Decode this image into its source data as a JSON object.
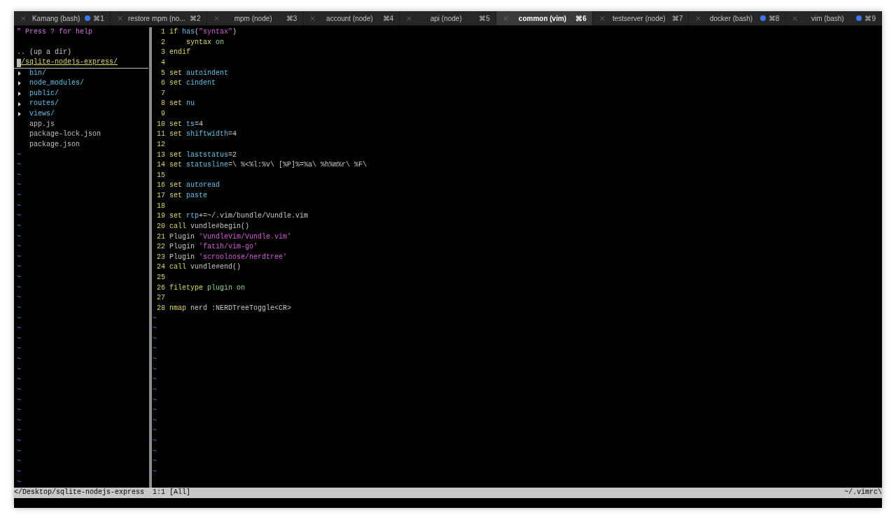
{
  "tabs": [
    {
      "title": "Kamang (bash)",
      "shortcut": "⌘1",
      "selected": false,
      "activity": true
    },
    {
      "title": "restore mpm (no...",
      "shortcut": "⌘2",
      "selected": false,
      "activity": false
    },
    {
      "title": "mpm (node)",
      "shortcut": "⌘3",
      "selected": false,
      "activity": false
    },
    {
      "title": "account (node)",
      "shortcut": "⌘4",
      "selected": false,
      "activity": false
    },
    {
      "title": "api (node)",
      "shortcut": "⌘5",
      "selected": false,
      "activity": false
    },
    {
      "title": "common (vim)",
      "shortcut": "⌘6",
      "selected": true,
      "activity": false
    },
    {
      "title": "testserver (node)",
      "shortcut": "⌘7",
      "selected": false,
      "activity": false
    },
    {
      "title": "docker (bash)",
      "shortcut": "⌘8",
      "selected": false,
      "activity": true
    },
    {
      "title": "vim (bash)",
      "shortcut": "⌘9",
      "selected": false,
      "activity": true
    }
  ],
  "tree": {
    "help": "\" Press ? for help",
    "up_dir": ".. (up a dir)",
    "root": "/sqlite-nodejs-express/",
    "items": [
      {
        "kind": "dir",
        "name": "bin/"
      },
      {
        "kind": "dir",
        "name": "node_modules/"
      },
      {
        "kind": "dir",
        "name": "public/"
      },
      {
        "kind": "dir",
        "name": "routes/"
      },
      {
        "kind": "dir",
        "name": "views/"
      },
      {
        "kind": "file",
        "name": "app.js"
      },
      {
        "kind": "file",
        "name": "package-lock.json"
      },
      {
        "kind": "file",
        "name": "package.json"
      }
    ],
    "filler": [
      "~",
      "~",
      "~",
      "~",
      "~",
      "~",
      "~",
      "~",
      "~",
      "~",
      "~",
      "~",
      "~",
      "~",
      "~",
      "~",
      "~",
      "~",
      "~",
      "~",
      "~",
      "~",
      "~",
      "~",
      "~",
      "~",
      "~",
      "~",
      "~",
      "~",
      "~",
      "~",
      "~"
    ]
  },
  "editor": {
    "lines": [
      {
        "number": "1",
        "segments": [
          {
            "kind": "kw",
            "text": "if "
          },
          {
            "kind": "opt",
            "text": "has"
          },
          {
            "kind": "plain",
            "text": "("
          },
          {
            "kind": "str",
            "text": "\"syntax\""
          },
          {
            "kind": "plain",
            "text": ")"
          }
        ]
      },
      {
        "number": "2",
        "segments": [
          {
            "kind": "kw",
            "text": "    syntax "
          },
          {
            "kind": "val",
            "text": "on"
          }
        ]
      },
      {
        "number": "3",
        "segments": [
          {
            "kind": "kw",
            "text": "endif"
          }
        ]
      },
      {
        "number": "4"
      },
      {
        "number": "5",
        "segments": [
          {
            "kind": "kw",
            "text": "set "
          },
          {
            "kind": "opt",
            "text": "autoindent"
          }
        ]
      },
      {
        "number": "6",
        "segments": [
          {
            "kind": "kw",
            "text": "set "
          },
          {
            "kind": "opt",
            "text": "cindent"
          }
        ]
      },
      {
        "number": "7"
      },
      {
        "number": "8",
        "segments": [
          {
            "kind": "kw",
            "text": "set "
          },
          {
            "kind": "opt",
            "text": "nu"
          }
        ]
      },
      {
        "number": "9"
      },
      {
        "number": "10",
        "segments": [
          {
            "kind": "kw",
            "text": "set "
          },
          {
            "kind": "opt",
            "text": "ts"
          },
          {
            "kind": "plain",
            "text": "=4"
          }
        ]
      },
      {
        "number": "11",
        "segments": [
          {
            "kind": "kw",
            "text": "set "
          },
          {
            "kind": "opt",
            "text": "shiftwidth"
          },
          {
            "kind": "plain",
            "text": "=4"
          }
        ]
      },
      {
        "number": "12"
      },
      {
        "number": "13",
        "segments": [
          {
            "kind": "kw",
            "text": "set "
          },
          {
            "kind": "opt",
            "text": "laststatus"
          },
          {
            "kind": "plain",
            "text": "=2"
          }
        ]
      },
      {
        "number": "14",
        "segments": [
          {
            "kind": "kw",
            "text": "set "
          },
          {
            "kind": "opt",
            "text": "statusline"
          },
          {
            "kind": "plain",
            "text": "=\\ %<%l:%v\\ [%P]%=%a\\ %h%m%r\\ %F\\"
          }
        ]
      },
      {
        "number": "15"
      },
      {
        "number": "16",
        "segments": [
          {
            "kind": "kw",
            "text": "set "
          },
          {
            "kind": "opt",
            "text": "autoread"
          }
        ]
      },
      {
        "number": "17",
        "segments": [
          {
            "kind": "kw",
            "text": "set "
          },
          {
            "kind": "opt",
            "text": "paste"
          }
        ]
      },
      {
        "number": "18"
      },
      {
        "number": "19",
        "segments": [
          {
            "kind": "kw",
            "text": "set "
          },
          {
            "kind": "opt",
            "text": "rtp"
          },
          {
            "kind": "plain",
            "text": "+=~/.vim/bundle/Vundle.vim"
          }
        ]
      },
      {
        "number": "20",
        "segments": [
          {
            "kind": "kw",
            "text": "call "
          },
          {
            "kind": "plain",
            "text": "vundle#begin()"
          }
        ]
      },
      {
        "number": "21",
        "segments": [
          {
            "kind": "plain",
            "text": "Plugin "
          },
          {
            "kind": "str",
            "text": "'VundleVim/Vundle.vim'"
          }
        ]
      },
      {
        "number": "22",
        "segments": [
          {
            "kind": "plain",
            "text": "Plugin "
          },
          {
            "kind": "str",
            "text": "'fatih/vim-go'"
          }
        ]
      },
      {
        "number": "23",
        "segments": [
          {
            "kind": "plain",
            "text": "Plugin "
          },
          {
            "kind": "str",
            "text": "'scrooloose/nerdtree'"
          }
        ]
      },
      {
        "number": "24",
        "segments": [
          {
            "kind": "kw",
            "text": "call "
          },
          {
            "kind": "plain",
            "text": "vundle#end()"
          }
        ]
      },
      {
        "number": "25"
      },
      {
        "number": "26",
        "segments": [
          {
            "kind": "kw",
            "text": "filetype "
          },
          {
            "kind": "val",
            "text": "plugin on"
          }
        ]
      },
      {
        "number": "27"
      },
      {
        "number": "28",
        "segments": [
          {
            "kind": "kw",
            "text": "nmap "
          },
          {
            "kind": "plain",
            "text": "nerd :NERDTreeToggle<CR>"
          }
        ]
      }
    ],
    "filler": [
      "~",
      "~",
      "~",
      "~",
      "~",
      "~",
      "~",
      "~",
      "~",
      "~",
      "~",
      "~",
      "~",
      "~",
      "~",
      "~"
    ]
  },
  "status_bar": {
    "path": "</Desktop/sqlite-nodejs-express",
    "position": "1:1 [All]",
    "file": "~/.vimrc\\"
  }
}
